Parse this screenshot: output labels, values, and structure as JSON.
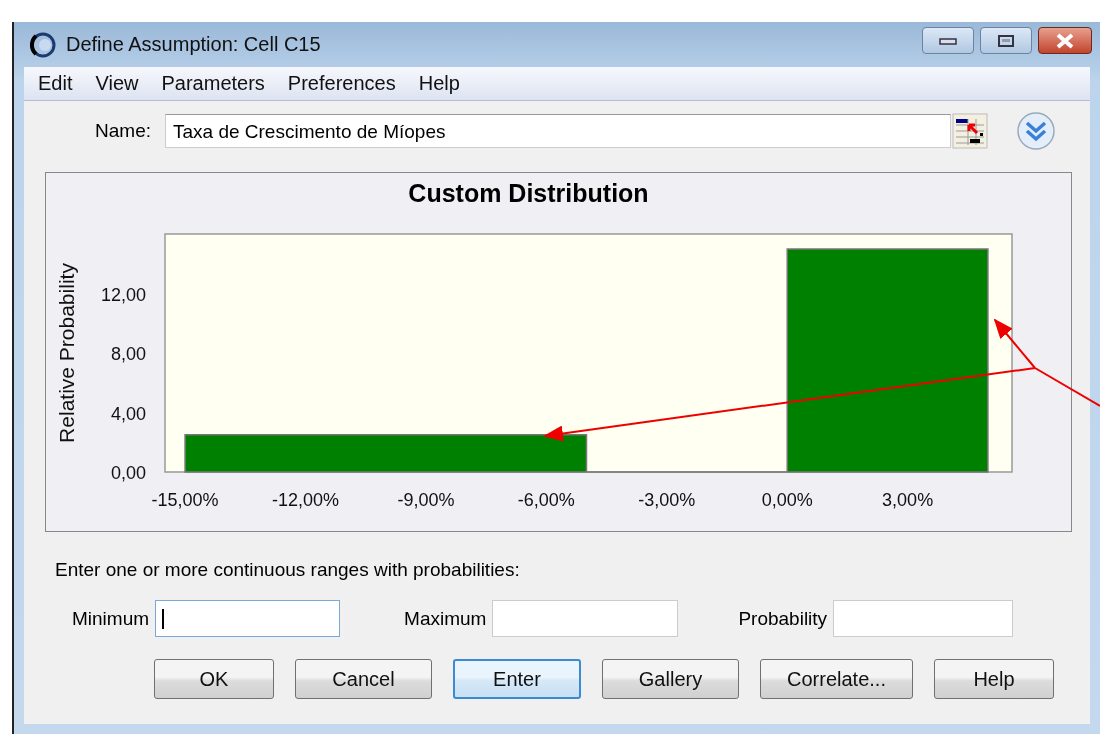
{
  "window": {
    "title": "Define Assumption: Cell C15"
  },
  "menu": [
    "Edit",
    "View",
    "Parameters",
    "Preferences",
    "Help"
  ],
  "name_field": {
    "label": "Name:",
    "value": "Taxa de Crescimento de Míopes"
  },
  "chart": {
    "chart_data": {
      "type": "area",
      "title": "Custom Distribution",
      "ylabel": "Relative Probability",
      "x": [
        -15,
        -5,
        -5,
        0,
        0,
        5
      ],
      "series": [
        {
          "color": "#008000",
          "values": [
            2.5,
            2.5,
            0,
            0,
            15,
            15
          ]
        }
      ],
      "xlim": [
        -15.5,
        5.6
      ],
      "ylim": [
        0,
        16
      ],
      "xticks": [
        {
          "value": -15,
          "label": "-15,00%"
        },
        {
          "value": -12,
          "label": "-12,00%"
        },
        {
          "value": -9,
          "label": "-9,00%"
        },
        {
          "value": -6,
          "label": "-6,00%"
        },
        {
          "value": -3,
          "label": "-3,00%"
        },
        {
          "value": 0,
          "label": "0,00%"
        },
        {
          "value": 3,
          "label": "3,00%"
        }
      ],
      "yticks": [
        {
          "value": 0,
          "label": "0,00"
        },
        {
          "value": 4,
          "label": "4,00"
        },
        {
          "value": 8,
          "label": "8,00"
        },
        {
          "value": 12,
          "label": "12,00"
        }
      ]
    }
  },
  "instructions": "Enter one or more continuous ranges with probabilities:",
  "inputs": [
    {
      "label": "Minimum",
      "focused": true
    },
    {
      "label": "Maximum",
      "focused": false
    },
    {
      "label": "Probability",
      "focused": false
    }
  ],
  "buttons": [
    {
      "label": "OK",
      "focused": false
    },
    {
      "label": "Cancel",
      "focused": false
    },
    {
      "label": "Enter",
      "focused": true
    },
    {
      "label": "Gallery",
      "focused": false
    },
    {
      "label": "Correlate...",
      "focused": false
    },
    {
      "label": "Help",
      "focused": false
    }
  ]
}
